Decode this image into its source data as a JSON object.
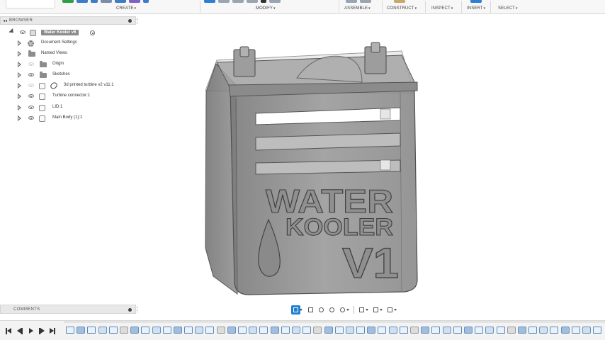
{
  "toolbar": {
    "groups": [
      {
        "label": "CREATE",
        "caret": "▾"
      },
      {
        "label": "MODIFY",
        "caret": "▾"
      },
      {
        "label": "ASSEMBLE",
        "caret": "▾"
      },
      {
        "label": "CONSTRUCT",
        "caret": "▾"
      },
      {
        "label": "INSPECT",
        "caret": "▾"
      },
      {
        "label": "INSERT",
        "caret": "▾"
      },
      {
        "label": "SELECT",
        "caret": "▾"
      }
    ]
  },
  "browser": {
    "title": "BROWSER",
    "collapse_glyph": "◂◂",
    "root": {
      "label": "Water Kooler v6"
    },
    "items": [
      {
        "label": "Document Settings",
        "icon": "gear-icon"
      },
      {
        "label": "Named Views",
        "icon": "folder-icon"
      },
      {
        "label": "Origin",
        "icon": "folder-icon"
      },
      {
        "label": "Sketches",
        "icon": "folder-icon"
      },
      {
        "label": "3d printed turbine v2 v11:1",
        "icon": "linked-component-icon"
      },
      {
        "label": "Turbine connector:1",
        "icon": "component-icon"
      },
      {
        "label": "LID:1",
        "icon": "component-icon"
      },
      {
        "label": "Main Body (1):1",
        "icon": "component-icon"
      }
    ]
  },
  "model": {
    "text_line1": "WATER",
    "text_line2": "KOOLER",
    "text_line3": "V1",
    "body_color": "#8a8a8a"
  },
  "comments": {
    "title": "COMMENTS"
  },
  "navbar": {
    "tools": [
      "orbit-icon",
      "grid-snap-icon",
      "pan-icon",
      "zoom-window-icon",
      "zoom-icon",
      "display-settings-icon",
      "grid-settings-icon",
      "viewports-icon"
    ]
  },
  "timeline": {
    "controls": [
      "go-to-start",
      "step-back",
      "play",
      "step-forward",
      "go-to-end"
    ],
    "feature_count": 50
  },
  "colors": {
    "accent": "#1f7fd1",
    "panel": "#e8e8e8",
    "root_highlight": "#8a8a8a"
  }
}
